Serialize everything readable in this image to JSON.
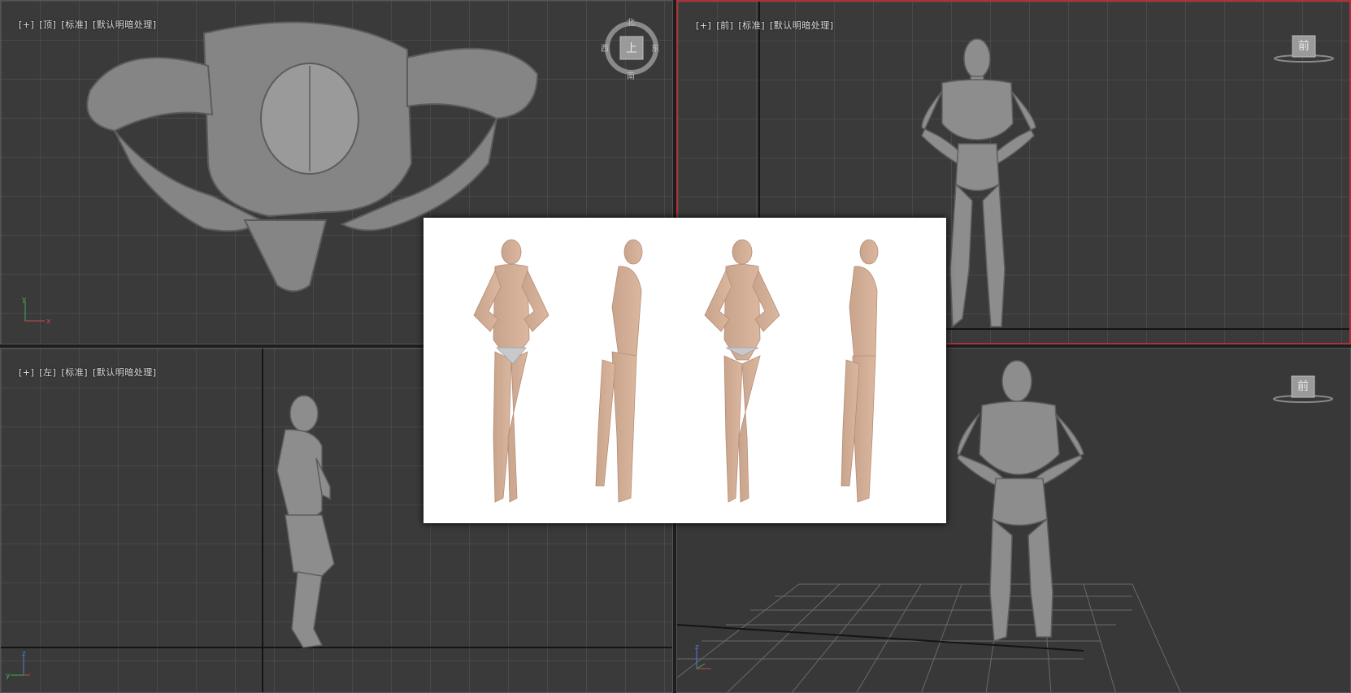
{
  "viewports": {
    "top": {
      "labels": [
        "[+]",
        "[顶]",
        "[标准]",
        "[默认明暗处理]"
      ],
      "cube_label": "上",
      "compass": {
        "north": "北",
        "south": "南",
        "east": "东",
        "west": "西"
      }
    },
    "front": {
      "labels": [
        "[+]",
        "[前]",
        "[标准]",
        "[默认明暗处理]"
      ],
      "cube_label": "前"
    },
    "left": {
      "labels": [
        "[+]",
        "[左]",
        "[标准]",
        "[默认明暗处理]"
      ]
    },
    "perspective": {
      "cube_label": "前"
    }
  },
  "axis_labels": {
    "x": "x",
    "y": "y",
    "z": "z"
  },
  "reference_image": {
    "subject": "four-view human reference: front, side, back, side"
  },
  "colors": {
    "viewport_bg": "#3c3c3c",
    "grid_minor": "#5a5a5a",
    "grid_major": "#141414",
    "active_border": "#b0303a",
    "model": "#8a8a8a"
  }
}
